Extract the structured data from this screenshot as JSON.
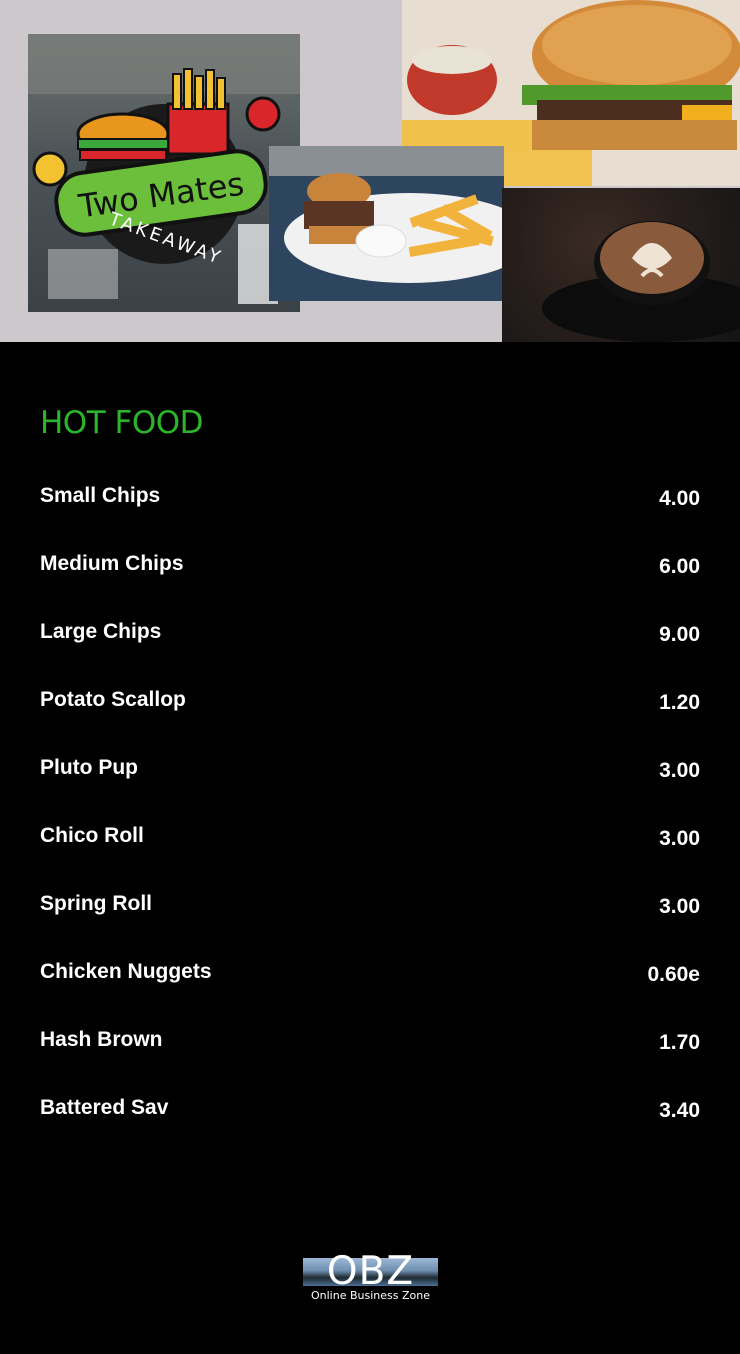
{
  "hero": {
    "logo_line1": "Two Mates",
    "logo_line2": "TAKEAWAY"
  },
  "section": {
    "title": "HOT FOOD"
  },
  "menu": [
    {
      "name": "Small Chips",
      "price": "4.00"
    },
    {
      "name": "Medium Chips",
      "price": "6.00"
    },
    {
      "name": "Large Chips",
      "price": "9.00"
    },
    {
      "name": "Potato Scallop",
      "price": "1.20"
    },
    {
      "name": "Pluto Pup",
      "price": "3.00"
    },
    {
      "name": "Chico Roll",
      "price": "3.00"
    },
    {
      "name": "Spring Roll",
      "price": "3.00"
    },
    {
      "name": "Chicken Nuggets",
      "price": "0.60e"
    },
    {
      "name": "Hash Brown",
      "price": "1.70"
    },
    {
      "name": "Battered Sav",
      "price": "3.40"
    }
  ],
  "footer": {
    "logo_text": "OBZ",
    "logo_sub": "Online Business Zone"
  },
  "colors": {
    "accent": "#2bb52b",
    "background": "#000000",
    "hero_bg": "#ccc8cc"
  }
}
